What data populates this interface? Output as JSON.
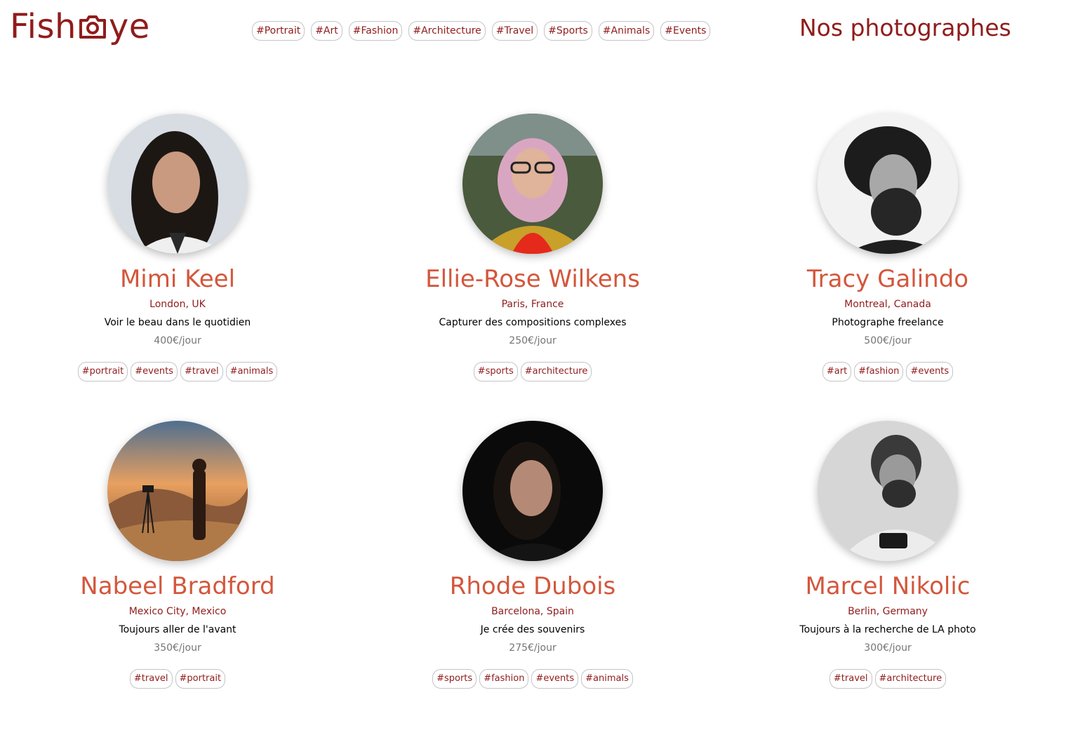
{
  "header": {
    "logo_left": "Fish",
    "logo_right": "ye",
    "page_title": "Nos photographes",
    "nav_tags": [
      "#Portrait",
      "#Art",
      "#Fashion",
      "#Architecture",
      "#Travel",
      "#Sports",
      "#Animals",
      "#Events"
    ]
  },
  "colors": {
    "brand": "#901c1c",
    "name_accent": "#d3573c",
    "price": "#757575",
    "tag_border": "#c4c4c4"
  },
  "photographers": [
    {
      "name": "Mimi Keel",
      "location": "London, UK",
      "tagline": "Voir le beau dans le quotidien",
      "price": "400€/jour",
      "tags": [
        "#portrait",
        "#events",
        "#travel",
        "#animals"
      ]
    },
    {
      "name": "Ellie-Rose Wilkens",
      "location": "Paris, France",
      "tagline": "Capturer des compositions complexes",
      "price": "250€/jour",
      "tags": [
        "#sports",
        "#architecture"
      ]
    },
    {
      "name": "Tracy Galindo",
      "location": "Montreal, Canada",
      "tagline": "Photographe freelance",
      "price": "500€/jour",
      "tags": [
        "#art",
        "#fashion",
        "#events"
      ]
    },
    {
      "name": "Nabeel Bradford",
      "location": "Mexico City, Mexico",
      "tagline": "Toujours aller de l'avant",
      "price": "350€/jour",
      "tags": [
        "#travel",
        "#portrait"
      ]
    },
    {
      "name": "Rhode Dubois",
      "location": "Barcelona, Spain",
      "tagline": "Je crée des souvenirs",
      "price": "275€/jour",
      "tags": [
        "#sports",
        "#fashion",
        "#events",
        "#animals"
      ]
    },
    {
      "name": "Marcel Nikolic",
      "location": "Berlin, Germany",
      "tagline": "Toujours à la recherche de LA photo",
      "price": "300€/jour",
      "tags": [
        "#travel",
        "#architecture"
      ]
    }
  ]
}
